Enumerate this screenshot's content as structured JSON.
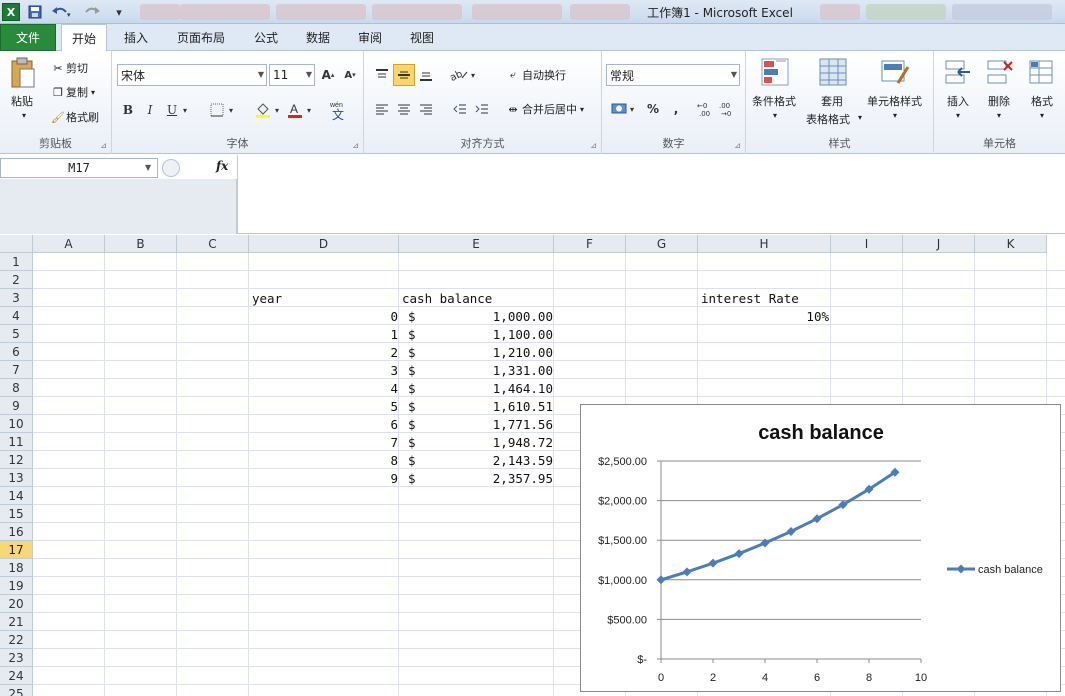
{
  "window": {
    "title": "工作簿1 - Microsoft Excel",
    "app_logo": "X"
  },
  "quick_access": {
    "save_icon": "save-icon",
    "undo_icon": "undo-icon",
    "redo_icon": "redo-icon"
  },
  "ribbon_tabs": [
    "文件",
    "开始",
    "插入",
    "页面布局",
    "公式",
    "数据",
    "审阅",
    "视图"
  ],
  "ribbon": {
    "clipboard": {
      "group": "剪贴板",
      "paste": "粘贴",
      "cut": "剪切",
      "copy": "复制",
      "format_painter": "格式刷"
    },
    "font": {
      "group": "字体",
      "name": "宋体",
      "size": "11",
      "bold": "B",
      "italic": "I",
      "underline": "U"
    },
    "alignment": {
      "group": "对齐方式",
      "wrap": "自动换行",
      "merge": "合并后居中"
    },
    "number": {
      "group": "数字",
      "format": "常规",
      "percent": "%",
      "comma": ",",
      "inc_decimal": ".00 →.0",
      "dec_decimal": ".00 →.0"
    },
    "styles": {
      "group": "样式",
      "conditional": "条件格式",
      "table_line1": "套用",
      "table_line2": "表格格式",
      "cell_styles": "单元格样式"
    },
    "cells": {
      "group": "单元格",
      "insert": "插入",
      "delete": "删除",
      "format": "格式"
    }
  },
  "formula_bar": {
    "name_box": "M17",
    "fx": "fx",
    "formula": ""
  },
  "columns": [
    "A",
    "B",
    "C",
    "D",
    "E",
    "F",
    "G",
    "H",
    "I",
    "J",
    "K"
  ],
  "rows": [
    "1",
    "2",
    "3",
    "4",
    "5",
    "6",
    "7",
    "8",
    "9",
    "10",
    "11",
    "12",
    "13",
    "14",
    "15",
    "16",
    "17",
    "18",
    "19",
    "20",
    "21",
    "22",
    "23",
    "24",
    "25"
  ],
  "selected_row": "17",
  "sheet": {
    "d3": "year",
    "e3": "cash balance",
    "h3": "interest Rate",
    "h4": "10%",
    "table": [
      {
        "year": "0",
        "cur": "$",
        "bal": "1,000.00"
      },
      {
        "year": "1",
        "cur": "$",
        "bal": "1,100.00"
      },
      {
        "year": "2",
        "cur": "$",
        "bal": "1,210.00"
      },
      {
        "year": "3",
        "cur": "$",
        "bal": "1,331.00"
      },
      {
        "year": "4",
        "cur": "$",
        "bal": "1,464.10"
      },
      {
        "year": "5",
        "cur": "$",
        "bal": "1,610.51"
      },
      {
        "year": "6",
        "cur": "$",
        "bal": "1,771.56"
      },
      {
        "year": "7",
        "cur": "$",
        "bal": "1,948.72"
      },
      {
        "year": "8",
        "cur": "$",
        "bal": "2,143.59"
      },
      {
        "year": "9",
        "cur": "$",
        "bal": "2,357.95"
      }
    ]
  },
  "chart_data": {
    "type": "line",
    "title": "cash balance",
    "x": [
      0,
      1,
      2,
      3,
      4,
      5,
      6,
      7,
      8,
      9
    ],
    "series": [
      {
        "name": "cash balance",
        "values": [
          1000,
          1100,
          1210,
          1331,
          1464.1,
          1610.51,
          1771.56,
          1948.72,
          2143.59,
          2357.95
        ]
      }
    ],
    "xlim": [
      0,
      10
    ],
    "ylim": [
      0,
      2500
    ],
    "xticks": [
      0,
      2,
      4,
      6,
      8,
      10
    ],
    "yticks": [
      0,
      500,
      1000,
      1500,
      2000,
      2500
    ],
    "ytick_labels": [
      "$-",
      "$500.00",
      "$1,000.00",
      "$1,500.00",
      "$2,000.00",
      "$2,500.00"
    ],
    "legend": "right",
    "grid": true,
    "color": "#4a7ebb"
  }
}
